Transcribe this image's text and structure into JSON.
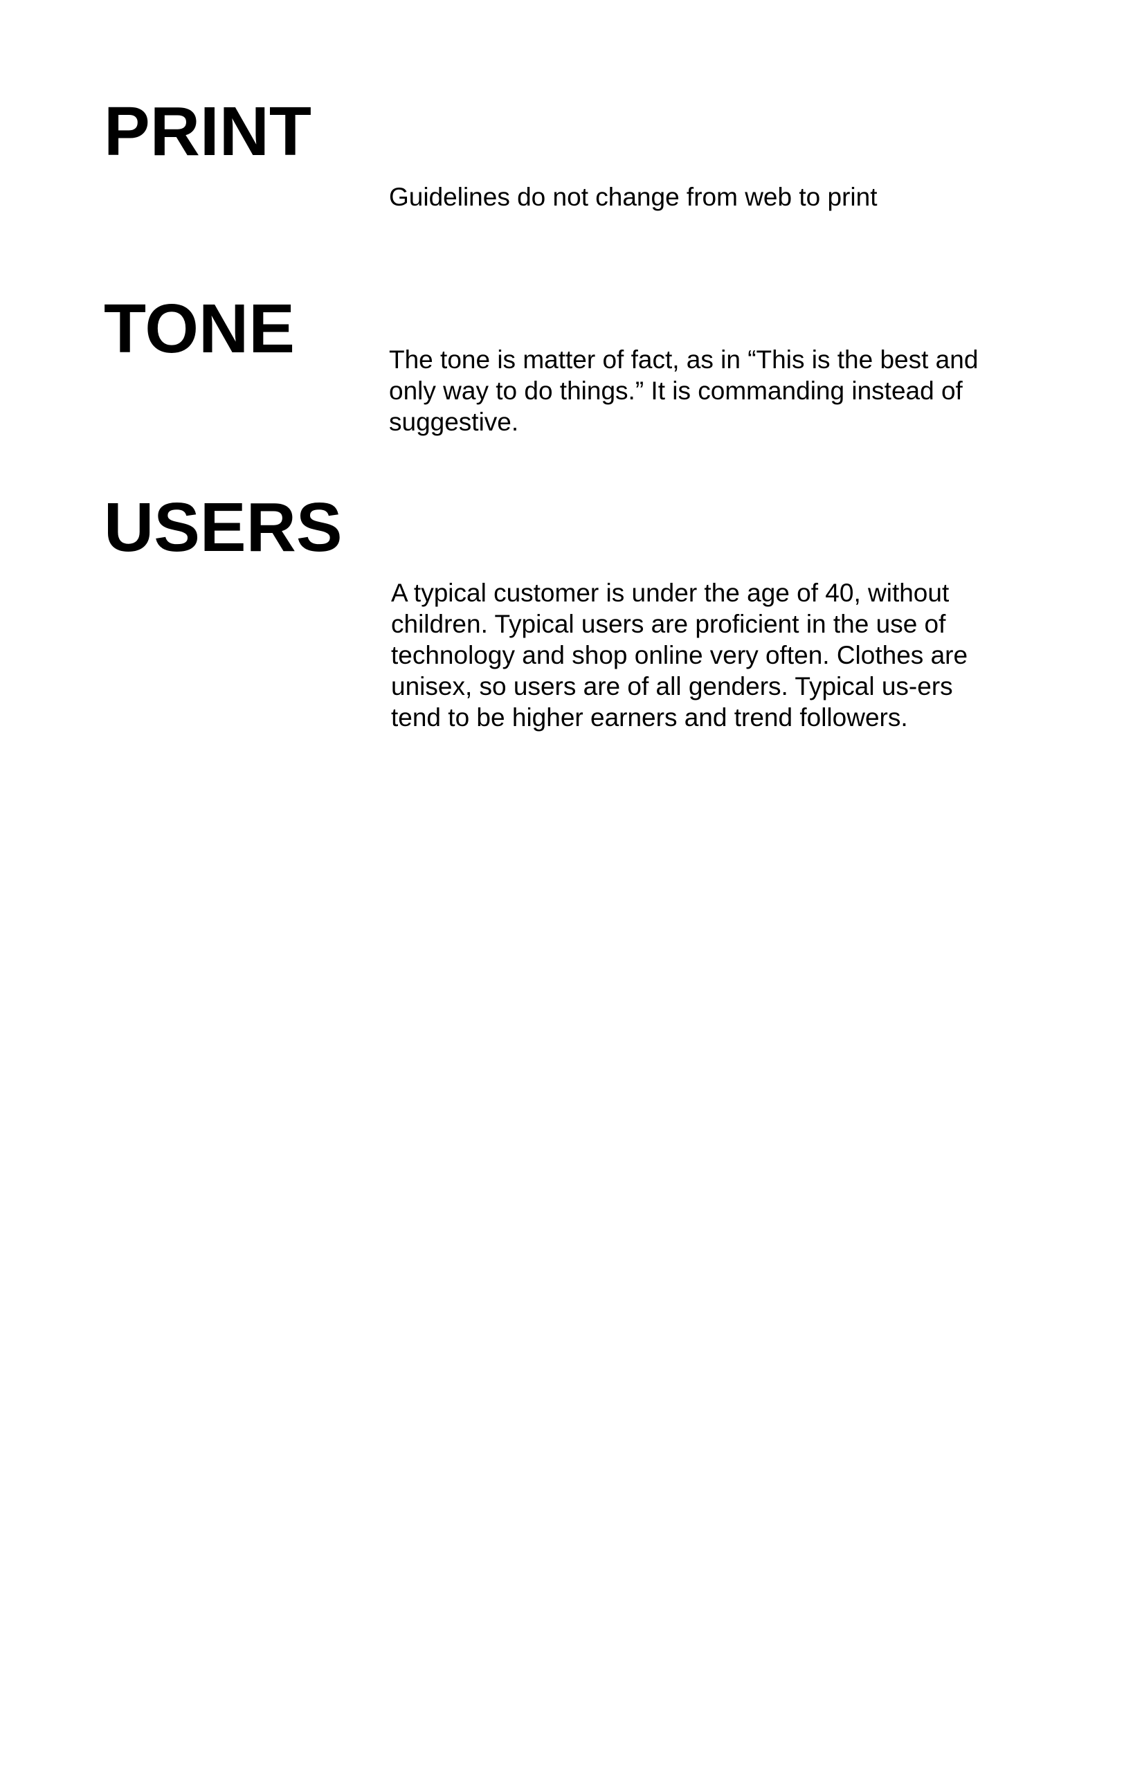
{
  "sections": [
    {
      "heading": "PRINT",
      "text": "Guidelines do not change from web to print"
    },
    {
      "heading": "TONE",
      "text": "The tone is matter of fact, as in “This is the best and only way to do things.” It is commanding instead of suggestive."
    },
    {
      "heading": "USERS",
      "text": "A typical customer is under the age of 40, without children. Typical users are proficient in the use of technology and shop online very often. Clothes are unisex, so users are of all genders. Typical us-ers tend to be higher earners and trend followers."
    }
  ]
}
